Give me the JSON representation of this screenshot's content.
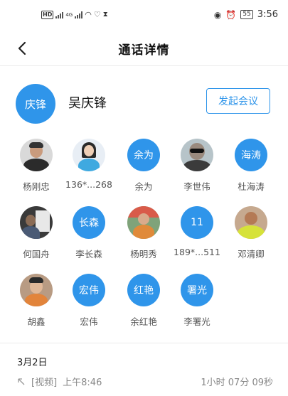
{
  "status_bar": {
    "left_badges": [
      "HD",
      "4G"
    ],
    "time": "3:56",
    "battery": "55"
  },
  "header": {
    "title": "通话详情"
  },
  "caller": {
    "avatar_text": "庆锋",
    "name": "吴庆锋",
    "meeting_button": "发起会议"
  },
  "members": [
    {
      "name": "杨刚忠",
      "avatar": "photo"
    },
    {
      "name": "136*...268",
      "avatar": "photo"
    },
    {
      "name": "余为",
      "avatar": "text",
      "avatar_text": "余为"
    },
    {
      "name": "李世伟",
      "avatar": "photo"
    },
    {
      "name": "杜海涛",
      "avatar": "text",
      "avatar_text": "海涛"
    },
    {
      "name": "何国舟",
      "avatar": "photo"
    },
    {
      "name": "李长森",
      "avatar": "text",
      "avatar_text": "长森"
    },
    {
      "name": "杨明秀",
      "avatar": "photo"
    },
    {
      "name": "189*...511",
      "avatar": "text",
      "avatar_text": "11"
    },
    {
      "name": "邓清卿",
      "avatar": "photo"
    },
    {
      "name": "胡鑫",
      "avatar": "photo"
    },
    {
      "name": "宏伟",
      "avatar": "text",
      "avatar_text": "宏伟"
    },
    {
      "name": "余红艳",
      "avatar": "text",
      "avatar_text": "红艳"
    },
    {
      "name": "李署光",
      "avatar": "text",
      "avatar_text": "署光"
    }
  ],
  "records": {
    "date": "3月2日",
    "items": [
      {
        "type": "[视频]",
        "time": "上午8:46",
        "duration": "1小时 07分 09秒"
      }
    ]
  },
  "colors": {
    "accent": "#2f95ea"
  }
}
